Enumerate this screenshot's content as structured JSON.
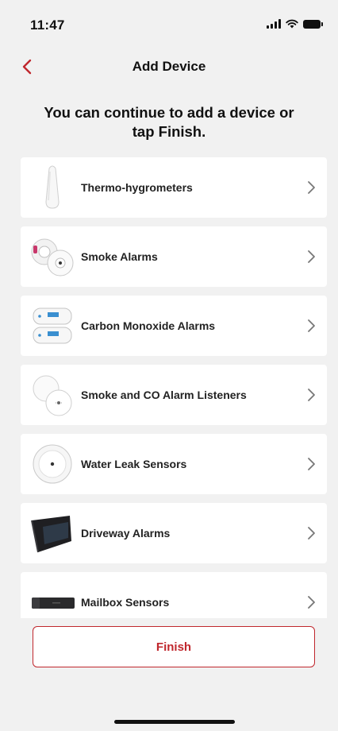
{
  "status_bar": {
    "time": "11:47",
    "icons": [
      "signal-icon",
      "wifi-icon",
      "battery-icon"
    ]
  },
  "nav": {
    "back_icon": "chevron-left-icon",
    "title": "Add Device"
  },
  "subtitle": "You can continue to add a device or tap Finish.",
  "devices": [
    {
      "label": "Thermo-hygrometers",
      "icon": "thermo-hygrometer-icon"
    },
    {
      "label": "Smoke Alarms",
      "icon": "smoke-alarm-icon"
    },
    {
      "label": "Carbon Monoxide Alarms",
      "icon": "co-alarm-icon"
    },
    {
      "label": "Smoke and CO Alarm Listeners",
      "icon": "alarm-listener-icon"
    },
    {
      "label": "Water Leak Sensors",
      "icon": "water-leak-sensor-icon"
    },
    {
      "label": "Driveway Alarms",
      "icon": "driveway-alarm-icon"
    },
    {
      "label": "Mailbox Sensors",
      "icon": "mailbox-sensor-icon"
    }
  ],
  "finish_label": "Finish",
  "colors": {
    "accent": "#c0272d",
    "background": "#f1f1f1",
    "card": "#ffffff"
  }
}
